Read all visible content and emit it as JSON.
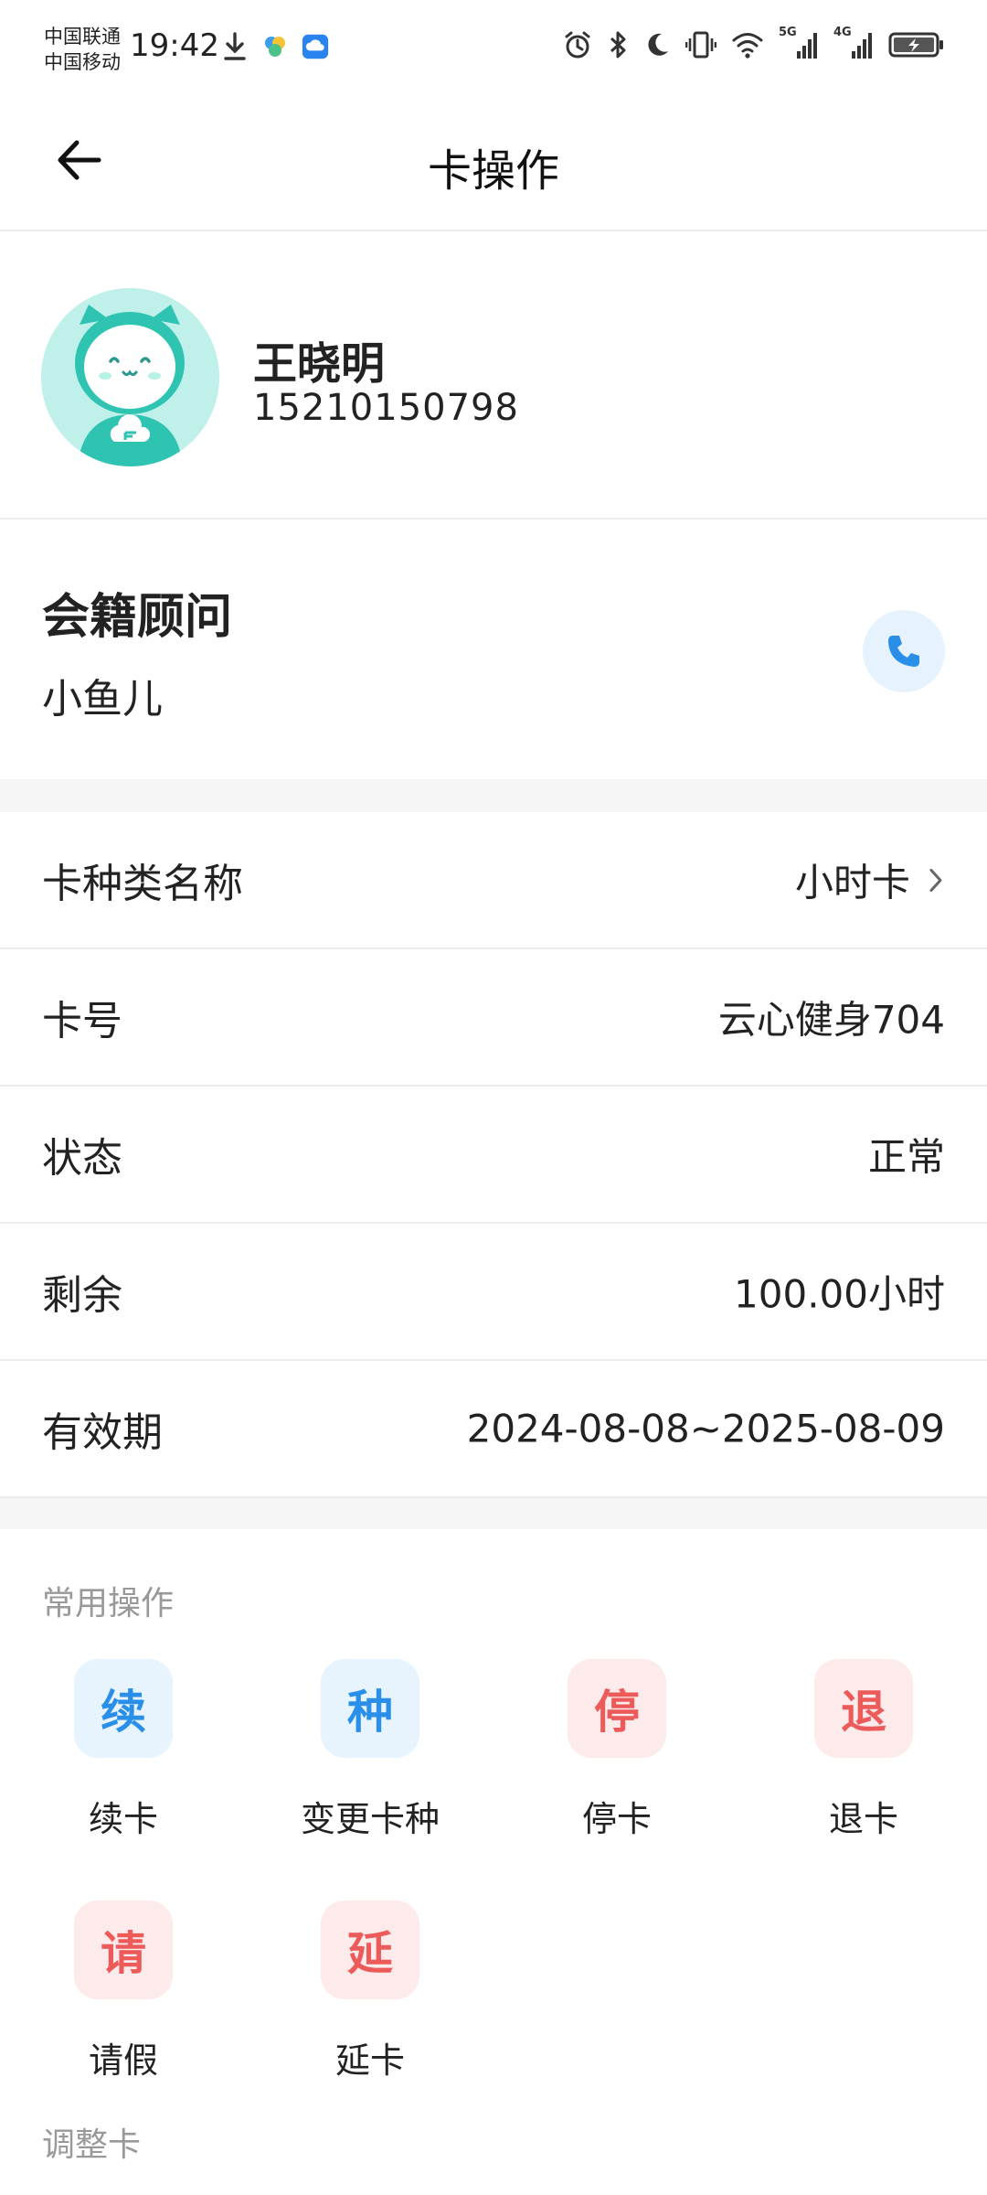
{
  "status_bar": {
    "carrier_1": "中国联通",
    "carrier_2": "中国移动",
    "time": "19:42",
    "left_icons": [
      "download-icon",
      "pinwheel-app-icon",
      "cloud-app-icon"
    ],
    "right_icons": [
      "alarm-icon",
      "bluetooth-icon",
      "moon-icon",
      "vibrate-icon",
      "wifi-icon",
      "signal-5g-icon",
      "signal-4g-icon",
      "battery-icon"
    ],
    "net_label_1": "5G",
    "net_label_2": "4G"
  },
  "header": {
    "title": "卡操作",
    "back_icon": "arrow-left-icon"
  },
  "member": {
    "name": "王晓明",
    "phone": "15210150798",
    "avatar_colors": {
      "bg": "#bff0ea",
      "body": "#2fc4b2"
    }
  },
  "advisor": {
    "label": "会籍顾问",
    "name": "小鱼儿",
    "call_icon": "phone-icon"
  },
  "card_info": [
    {
      "label": "卡种类名称",
      "value": "小时卡",
      "has_arrow": true
    },
    {
      "label": "卡号",
      "value": "云心健身704",
      "has_arrow": false
    },
    {
      "label": "状态",
      "value": "正常",
      "has_arrow": false
    },
    {
      "label": "剩余",
      "value": "100.00小时",
      "has_arrow": false
    },
    {
      "label": "有效期",
      "value": "2024-08-08~2025-08-09",
      "has_arrow": false
    }
  ],
  "operations": {
    "section_title": "常用操作",
    "items": [
      {
        "glyph": "续",
        "label": "续卡",
        "tone": "blue"
      },
      {
        "glyph": "种",
        "label": "变更卡种",
        "tone": "blue"
      },
      {
        "glyph": "停",
        "label": "停卡",
        "tone": "red"
      },
      {
        "glyph": "退",
        "label": "退卡",
        "tone": "red"
      },
      {
        "glyph": "请",
        "label": "请假",
        "tone": "red"
      },
      {
        "glyph": "延",
        "label": "延卡",
        "tone": "red"
      }
    ],
    "next_section_title": "调整卡"
  },
  "colors": {
    "accent_blue": "#2a8fe8",
    "accent_red": "#ec5a5a",
    "divider": "#ececec",
    "band": "#f5f5f5"
  }
}
